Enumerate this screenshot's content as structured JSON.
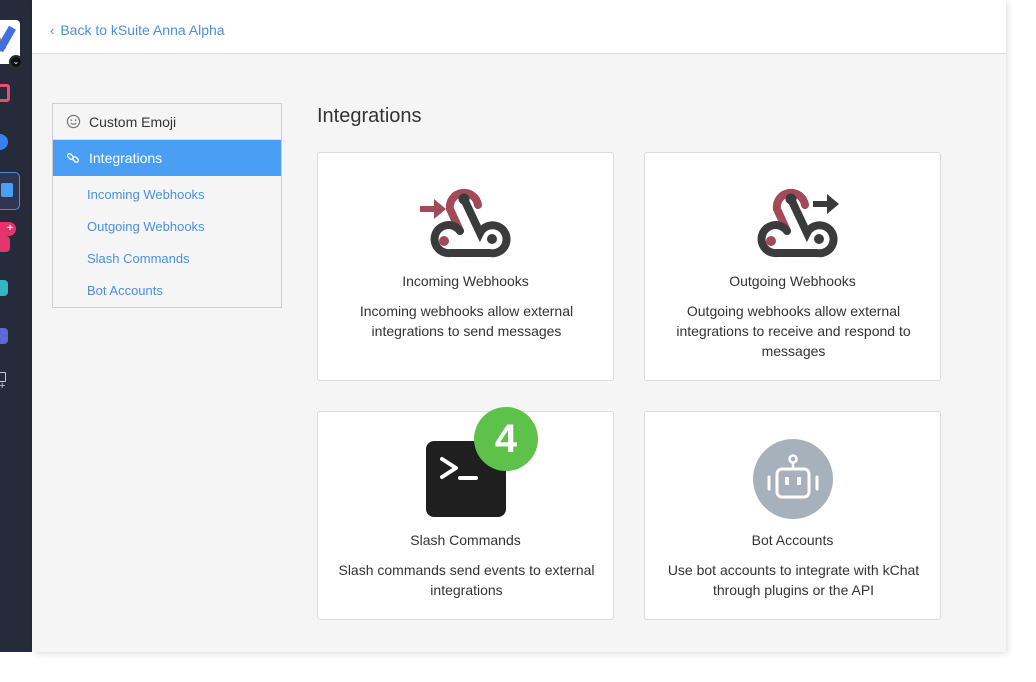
{
  "topbar": {
    "back_label": "Back to kSuite Anna Alpha"
  },
  "sidebar": {
    "custom_emoji": "Custom Emoji",
    "integrations": "Integrations",
    "sub_items": [
      "Incoming Webhooks",
      "Outgoing Webhooks",
      "Slash Commands",
      "Bot Accounts"
    ]
  },
  "content": {
    "title": "Integrations",
    "cards": [
      {
        "title": "Incoming Webhooks",
        "desc": "Incoming webhooks allow external integrations to send messages",
        "icon": "webhook-incoming-icon"
      },
      {
        "title": "Outgoing Webhooks",
        "desc": "Outgoing webhooks allow external integrations to receive and respond to messages",
        "icon": "webhook-outgoing-icon"
      },
      {
        "title": "Slash Commands",
        "desc": "Slash commands send events to external integrations",
        "icon": "terminal-icon"
      },
      {
        "title": "Bot Accounts",
        "desc": "Use bot accounts to integrate with kChat through plugins or the API",
        "icon": "robot-icon"
      }
    ]
  },
  "step_badge": "4",
  "colors": {
    "accent": "#4a9ff5",
    "link": "#4a90e2",
    "badge": "#5ec24a",
    "webhook_red": "#a24a58",
    "webhook_dark": "#3b3b3b"
  }
}
